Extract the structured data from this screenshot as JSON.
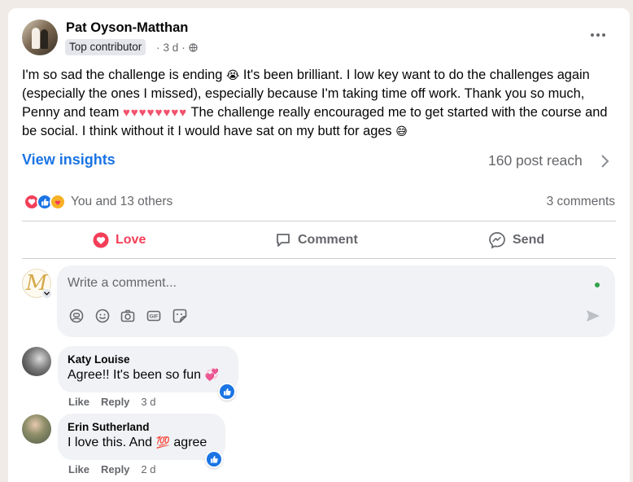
{
  "post": {
    "author": "Pat Oyson-Matthan",
    "badge": "Top contributor",
    "time": "3 d",
    "dot": "·",
    "text_1": "I'm so sad the challenge is ending",
    "emoji_crying": "😭",
    "text_2": " It's been brilliant. I low key want to do the challenges again (especially the ones I missed), especially because I'm taking time off work. Thank you so much, Penny and team ",
    "hearts": "♥♥♥♥♥♥♥♥",
    "text_3": " The challenge really encouraged me to get started with the course and be social. I think without it I would have sat on my butt for ages",
    "emoji_grin": "😅"
  },
  "insights": {
    "link_label": "View insights",
    "reach": "160 post reach"
  },
  "reactions": {
    "label": "You and 13 others",
    "comments": "3 comments"
  },
  "actions": {
    "love": "Love",
    "comment": "Comment",
    "send": "Send"
  },
  "composer": {
    "avatar_letter": "M",
    "placeholder": "Write a comment..."
  },
  "comments": [
    {
      "name": "Katy Louise",
      "text": "Agree!! It's been so fun",
      "emoji": "💞",
      "like": "Like",
      "reply": "Reply",
      "time": "3 d"
    },
    {
      "name": "Erin Sutherland",
      "text_1": "I love this. And ",
      "emoji": "💯",
      "text_2": " agree",
      "like": "Like",
      "reply": "Reply",
      "time": "2 d"
    }
  ],
  "colors": {
    "accent": "#1b74e4",
    "love": "#f33e58",
    "muted": "#65676b",
    "page_bg": "#f0ebe6",
    "online": "#31a24c"
  },
  "icons": {
    "more": "more-horizontal-icon",
    "privacy": "globe-icon",
    "chevron": "chevron-right-icon",
    "love": "heart-icon",
    "comment": "comment-bubble-icon",
    "send": "messenger-icon",
    "tools": [
      "avatar-sticker-icon",
      "emoji-icon",
      "camera-icon",
      "gif-icon",
      "sticker-icon"
    ],
    "submit": "send-arrow-icon"
  }
}
